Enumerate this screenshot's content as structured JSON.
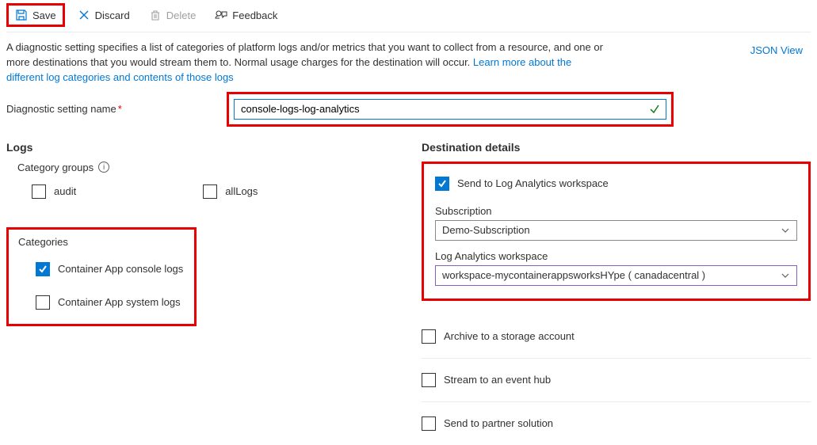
{
  "toolbar": {
    "save": "Save",
    "discard": "Discard",
    "delete": "Delete",
    "feedback": "Feedback"
  },
  "description": {
    "text1": "A diagnostic setting specifies a list of categories of platform logs and/or metrics that you want to collect from a resource, and one or more destinations that you would stream them to. Normal usage charges for the destination will occur. ",
    "link": "Learn more about the different log categories and contents of those logs"
  },
  "json_view": "JSON View",
  "name": {
    "label": "Diagnostic setting name",
    "value": "console-logs-log-analytics"
  },
  "logs": {
    "heading": "Logs",
    "category_groups_label": "Category groups",
    "groups": {
      "audit": "audit",
      "allLogs": "allLogs"
    },
    "categories_label": "Categories",
    "cat_console": "Container App console logs",
    "cat_system": "Container App system logs"
  },
  "dest": {
    "heading": "Destination details",
    "send_la": "Send to Log Analytics workspace",
    "subscription_label": "Subscription",
    "subscription_value": "Demo-Subscription",
    "workspace_label": "Log Analytics workspace",
    "workspace_value": "workspace-mycontainerappsworksHYpe ( canadacentral )",
    "archive": "Archive to a storage account",
    "stream": "Stream to an event hub",
    "partner": "Send to partner solution"
  }
}
